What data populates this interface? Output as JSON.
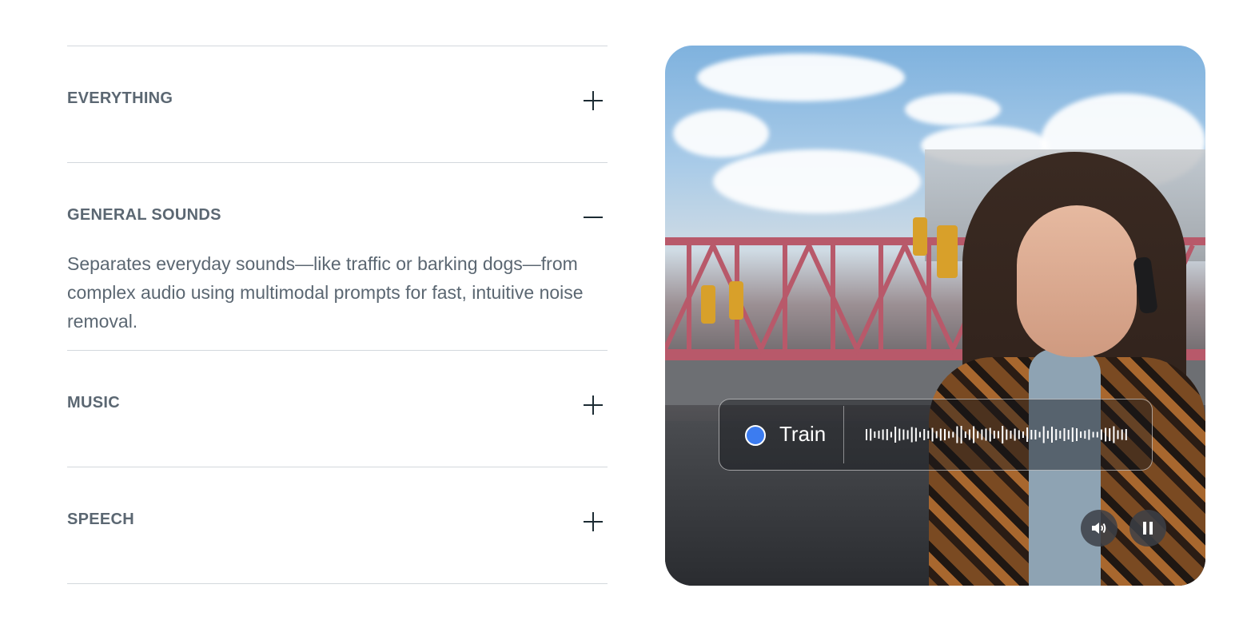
{
  "accordion": {
    "items": [
      {
        "title": "EVERYTHING",
        "state": "collapsed"
      },
      {
        "title": "GENERAL SOUNDS",
        "state": "expanded",
        "body": "Separates everyday sounds—like traffic or barking dogs—from complex audio using multimodal prompts for fast, intuitive noise removal."
      },
      {
        "title": "MUSIC",
        "state": "collapsed"
      },
      {
        "title": "SPEECH",
        "state": "collapsed"
      }
    ]
  },
  "video": {
    "sound_tag": {
      "label": "Train",
      "dot_color": "#3c7cf0"
    },
    "controls": {
      "volume_icon": "speaker-icon",
      "pause_icon": "pause-icon"
    }
  }
}
